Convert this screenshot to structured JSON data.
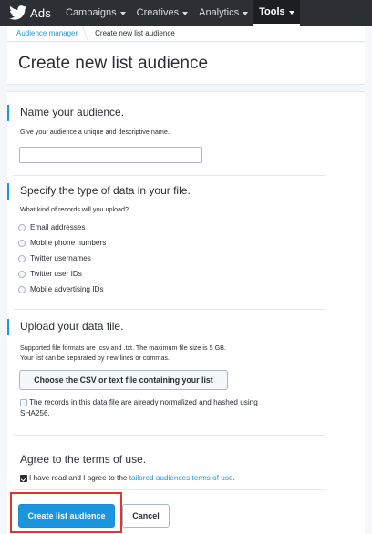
{
  "nav": {
    "brand": "Ads",
    "brand_icon": "twitter-bird-icon",
    "items": [
      {
        "label": "Campaigns"
      },
      {
        "label": "Creatives"
      },
      {
        "label": "Analytics"
      },
      {
        "label": "Tools"
      }
    ],
    "active": "Tools"
  },
  "breadcrumb": {
    "parent": "Audience manager",
    "current": "Create new list audience"
  },
  "header": {
    "title": "Create new list audience"
  },
  "name_section": {
    "title": "Name your audience.",
    "description": "Give your audience a unique and descriptive name.",
    "input_value": ""
  },
  "type_section": {
    "title": "Specify the type of data in your file.",
    "question": "What kind of records will you upload?",
    "options": [
      {
        "label": "Email addresses"
      },
      {
        "label": "Mobile phone numbers"
      },
      {
        "label": "Twitter usernames"
      },
      {
        "label": "Twitter user IDs"
      },
      {
        "label": "Mobile advertising IDs"
      }
    ]
  },
  "upload_section": {
    "title": "Upload your data file.",
    "desc_line1": "Supported file formats are .csv and .txt. The maximum file size is 5 GB.",
    "desc_line2": "Your list can be separated by new lines or commas.",
    "button_label": "Choose the CSV or text file containing your list",
    "hashed_label_line1": "The records in this data file are already normalized and hashed using",
    "hashed_label_line2": "SHA256."
  },
  "terms_section": {
    "title": "Agree to the terms of use.",
    "agree_prefix": "I have read and I agree to the ",
    "agree_link": "tailored audiences terms of use",
    "agree_suffix": ".",
    "checked": true
  },
  "actions": {
    "create_label": "Create list audience",
    "cancel_label": "Cancel"
  },
  "colors": {
    "accent": "#1b95e0",
    "nav_bg": "#2c2f33",
    "highlight": "#e0352b"
  }
}
